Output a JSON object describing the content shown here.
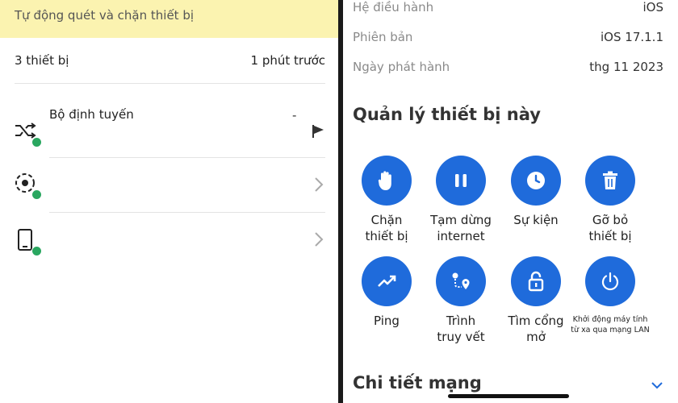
{
  "left": {
    "banner": "Tự động quét và chặn thiết bị",
    "device_count": "3 thiết bị",
    "last_scan": "1 phút trước",
    "devices": [
      {
        "name": "Bộ định tuyến",
        "value": "-"
      },
      {
        "name": ""
      },
      {
        "name": ""
      }
    ]
  },
  "right": {
    "info": [
      {
        "key": "Hệ điều hành",
        "value": "iOS"
      },
      {
        "key": "Phiên bản",
        "value": "iOS 17.1.1"
      },
      {
        "key": "Ngày phát hành",
        "value": "thg 11 2023"
      }
    ],
    "manage_title": "Quản lý thiết bị này",
    "actions": [
      {
        "line1": "Chặn",
        "line2": "thiết bị",
        "icon": "hand-icon"
      },
      {
        "line1": "Tạm dừng",
        "line2": "internet",
        "icon": "pause-icon"
      },
      {
        "line1": "Sự kiện",
        "line2": "",
        "icon": "clock-icon"
      },
      {
        "line1": "Gỡ bỏ",
        "line2": "thiết bị",
        "icon": "trash-icon"
      },
      {
        "line1": "Ping",
        "line2": "",
        "icon": "trend-icon"
      },
      {
        "line1": "Trình",
        "line2": "truy vết",
        "icon": "route-icon"
      },
      {
        "line1": "Tìm cổng",
        "line2": "mở",
        "icon": "lock-icon"
      },
      {
        "line1": "Khởi động máy tính",
        "line2": "từ xa qua mạng LAN",
        "icon": "power-icon"
      }
    ],
    "network_title": "Chi tiết mạng"
  },
  "colors": {
    "accent": "#1f6bdb",
    "online": "#2aa760",
    "banner": "#fbf3b0"
  }
}
